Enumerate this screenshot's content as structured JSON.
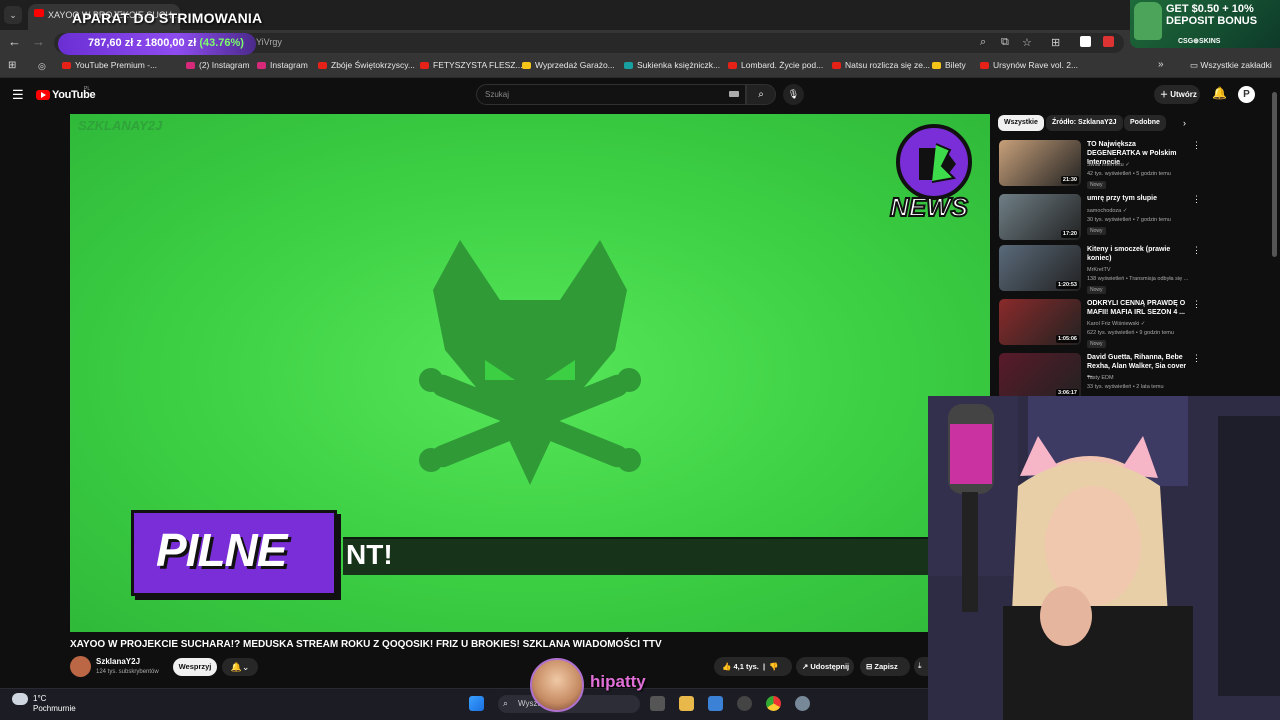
{
  "browser": {
    "tab_title": "XAYOO W PROJEKCIE SUCH...",
    "overlay_title": "APARAT DO STRIMOWANIA",
    "goal": {
      "amount": "787,60 zł z 1800,00 zł",
      "percent": "(43.76%)"
    },
    "url": "...mlhYiVrgy",
    "bookmarks": [
      {
        "label": "YouTube Premium -...",
        "color": "#e62117"
      },
      {
        "label": "(2) Instagram",
        "color": "#d6297a"
      },
      {
        "label": "Instagram",
        "color": "#d6297a"
      },
      {
        "label": "Zbóje Świętokrzyscy...",
        "color": "#e62117"
      },
      {
        "label": "FETYSZYSTA FLESZ...",
        "color": "#e62117"
      },
      {
        "label": "Wyprzedaż Garażo...",
        "color": "#f5c518"
      },
      {
        "label": "Sukienka księżniczk...",
        "color": "#18a0a0"
      },
      {
        "label": "Lombard. Życie pod...",
        "color": "#e62117"
      },
      {
        "label": "Natsu rozlicza się ze...",
        "color": "#e62117"
      },
      {
        "label": "Bilety",
        "color": "#f5c518"
      },
      {
        "label": "Ursynów Rave vol. 2...",
        "color": "#e62117"
      }
    ],
    "all_bookmarks": "Wszystkie zakładki"
  },
  "ad": {
    "line1": "GET $0.50 + 10%",
    "line2": "DEPOSIT BONUS",
    "brand": "CSG⊕SKINS"
  },
  "youtube": {
    "logo": "YouTube",
    "region": "PL",
    "search_placeholder": "Szukaj",
    "create_label": "Utwórz",
    "avatar_letter": "P"
  },
  "video": {
    "watermark": "SZKLANAY2J",
    "news_logo": "NEWS",
    "pilne": "PILNE",
    "ticker": "NT!",
    "title": "XAYOO W PROJEKCIE SUCHARA!? MEDUSKA STREAM ROKU Z QOQOSIK! FRIZ U BROKIES! SZKLANA WIADOMOŚCI TTV",
    "channel": "SzklanaY2J",
    "subscribers": "124 tys. subskrybentów",
    "support_label": "Wesprzyj",
    "likes": "4,1 tys.",
    "share_label": "Udostępnij",
    "save_label": "Zapisz"
  },
  "chips": [
    "Wszystkie",
    "Źródło: SzklanaY2J",
    "Podobne"
  ],
  "recommendations": [
    {
      "title": "TO Największa DEGENERATKA w Polskim Internecie",
      "channel": "Świat Internetu ✓",
      "meta": "42 tys. wyświetleń • 5 godzin temu",
      "badge": "Nowy",
      "duration": "21:30",
      "thumb": "#c7a07a"
    },
    {
      "title": "umrę przy tym słupie",
      "channel": "samochodoza ✓",
      "meta": "30 tys. wyświetleń • 7 godzin temu",
      "badge": "Nowy",
      "duration": "17:20",
      "thumb": "#6f7f86"
    },
    {
      "title": "Kiteny i smoczek (prawie koniec)",
      "channel": "MrKretTV",
      "meta": "138 wyświetleń • Transmisja odbyła się ...",
      "badge": "Nowy",
      "duration": "1:20:53",
      "thumb": "#5a6a7a"
    },
    {
      "title": "ODKRYLI CENNĄ PRAWDĘ O MAFII! MAFIA IRL SEZON 4 ...",
      "channel": "Karol Friz Wiśniewski ✓",
      "meta": "622 tys. wyświetleń • 9 godzin temu",
      "badge": "Nowy",
      "duration": "1:05:06",
      "thumb": "#8a2a2a"
    },
    {
      "title": "David Guetta, Rihanna, Bebe Rexha, Alan Walker, Sia cover ...",
      "channel": "Tasty EDM",
      "meta": "33 tys. wyświetleń • 2 lata temu",
      "badge": "",
      "duration": "3:06:17",
      "thumb": "#5a1a2a"
    }
  ],
  "taskbar": {
    "temp": "1°C",
    "weather": "Pochmurnie",
    "search_placeholder": "Wyszukaj"
  },
  "stream": {
    "name": "hipatty"
  }
}
